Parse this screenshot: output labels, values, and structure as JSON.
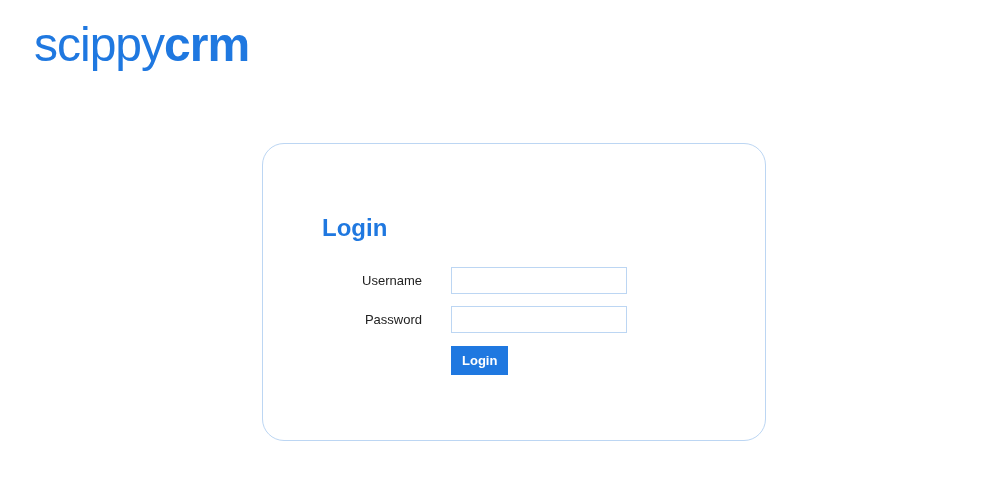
{
  "logo": "scippy**crm**",
  "login": {
    "title": "Login",
    "fields": [
      {
        "label": "Username"
      },
      {
        "label": "Password"
      }
    ],
    "button": "Login"
  }
}
